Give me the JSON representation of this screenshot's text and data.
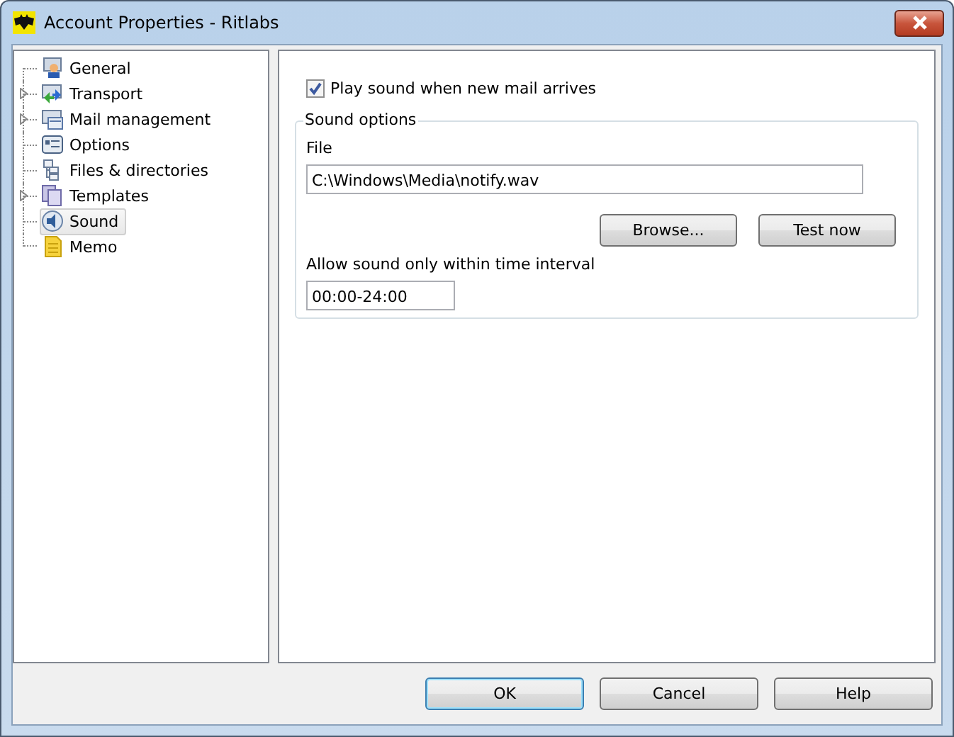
{
  "window": {
    "title": "Account Properties - Ritlabs"
  },
  "tree": {
    "items": [
      {
        "label": "General",
        "expandable": false,
        "selected": false
      },
      {
        "label": "Transport",
        "expandable": true,
        "selected": false
      },
      {
        "label": "Mail management",
        "expandable": true,
        "selected": false
      },
      {
        "label": "Options",
        "expandable": false,
        "selected": false
      },
      {
        "label": "Files & directories",
        "expandable": false,
        "selected": false
      },
      {
        "label": "Templates",
        "expandable": true,
        "selected": false
      },
      {
        "label": "Sound",
        "expandable": false,
        "selected": true
      },
      {
        "label": "Memo",
        "expandable": false,
        "selected": false
      }
    ]
  },
  "play_sound": {
    "label": "Play sound when new mail arrives",
    "checked": true
  },
  "sound_options": {
    "title": "Sound options",
    "file_label": "File",
    "file_value": "C:\\Windows\\Media\\notify.wav",
    "buttons": [
      {
        "label": "Browse..."
      },
      {
        "label": "Test now"
      }
    ],
    "interval_label": "Allow sound only within time interval",
    "interval_value": "00:00-24:00"
  },
  "dialog_buttons": [
    {
      "label": "OK",
      "default": true
    },
    {
      "label": "Cancel",
      "default": false
    },
    {
      "label": "Help",
      "default": false
    }
  ]
}
